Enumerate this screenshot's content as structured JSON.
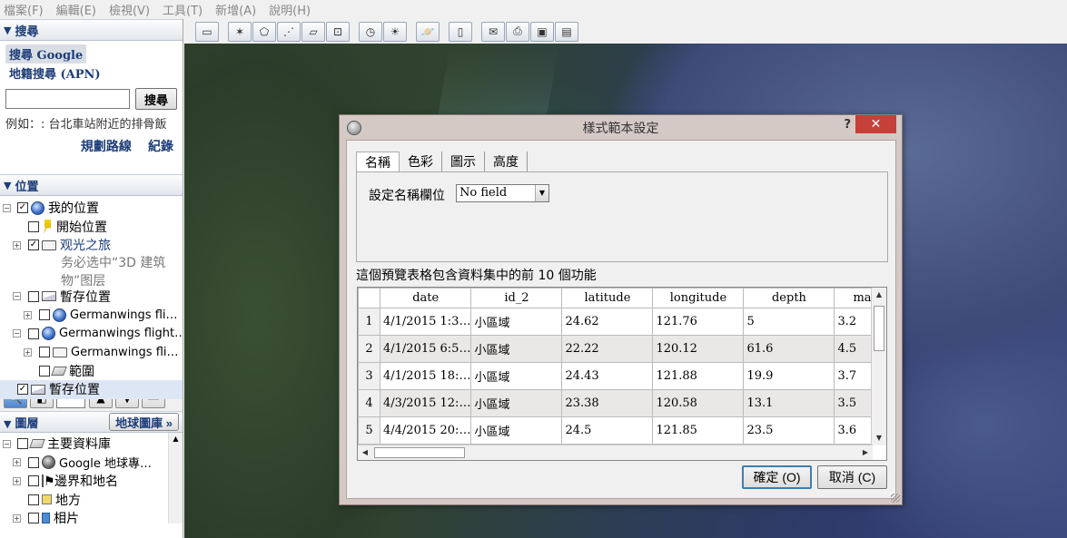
{
  "menu": [
    "檔案(F)",
    "編輯(E)",
    "檢視(V)",
    "工具(T)",
    "新增(A)",
    "說明(H)"
  ],
  "search": {
    "header": "搜尋",
    "tabs": [
      "搜尋 Google",
      "地籍搜尋 (APN)"
    ],
    "input_value": "",
    "button_label": "搜尋",
    "example": "例如：: 台北車站附近的排骨飯",
    "links": [
      "規劃路線",
      "紀錄"
    ]
  },
  "places": {
    "header": "位置",
    "items": [
      {
        "label": "我的位置",
        "desc": ""
      },
      {
        "label": "開始位置"
      },
      {
        "label": "观光之旅"
      },
      {
        "desc1": "务必选中“3D 建筑",
        "desc2": "物”图层"
      },
      {
        "label": "暫存位置"
      },
      {
        "label": "Germanwings fli…"
      },
      {
        "label": "Germanwings flight…"
      },
      {
        "label": "Germanwings fli…"
      },
      {
        "label": "範圍"
      },
      {
        "label": "暫存位置"
      }
    ]
  },
  "layers": {
    "header": "圖層",
    "gallery_button": "地球圖庫 »",
    "items": [
      "主要資料庫",
      "Google 地球專…",
      "邊界和地名",
      "地方",
      "相片"
    ]
  },
  "toolbar": {
    "icons": [
      "sidebar-toggle-icon",
      "placemark-icon",
      "polygon-icon",
      "path-icon",
      "image-overlay-icon",
      "record-tour-icon",
      "historical-imagery-icon",
      "sunlight-icon",
      "planets-icon",
      "ruler-icon",
      "email-icon",
      "print-icon",
      "view-in-maps-icon",
      "save-image-icon"
    ]
  },
  "dialog": {
    "title": "樣式範本設定",
    "help": "?",
    "close": "✕",
    "tabs": [
      "名稱",
      "色彩",
      "圖示",
      "高度"
    ],
    "name_field_label": "設定名稱欄位",
    "name_field_value": "No field",
    "preview_caption": "這個預覽表格包含資料集中的前 10 個功能",
    "columns": [
      "date",
      "id_2",
      "latitude",
      "longitude",
      "depth",
      "mag"
    ],
    "rows": [
      {
        "n": "1",
        "cells": [
          "4/1/2015 1:3…",
          "小區域",
          "24.62",
          "121.76",
          "5",
          "3.2"
        ]
      },
      {
        "n": "2",
        "cells": [
          "4/1/2015 6:5…",
          "小區域",
          "22.22",
          "120.12",
          "61.6",
          "4.5"
        ]
      },
      {
        "n": "3",
        "cells": [
          "4/1/2015 18:…",
          "小區域",
          "24.43",
          "121.88",
          "19.9",
          "3.7"
        ]
      },
      {
        "n": "4",
        "cells": [
          "4/3/2015 12:…",
          "小區域",
          "23.38",
          "120.58",
          "13.1",
          "3.5"
        ]
      },
      {
        "n": "5",
        "cells": [
          "4/4/2015 20:…",
          "小區域",
          "24.5",
          "121.85",
          "23.5",
          "3.6"
        ]
      }
    ],
    "ok_label": "確定 (O)",
    "cancel_label": "取消 (C)"
  },
  "colors": {
    "accent_blue": "#1d3d79",
    "dialog_frame": "#d5c9c5",
    "close_red": "#c6403a"
  }
}
